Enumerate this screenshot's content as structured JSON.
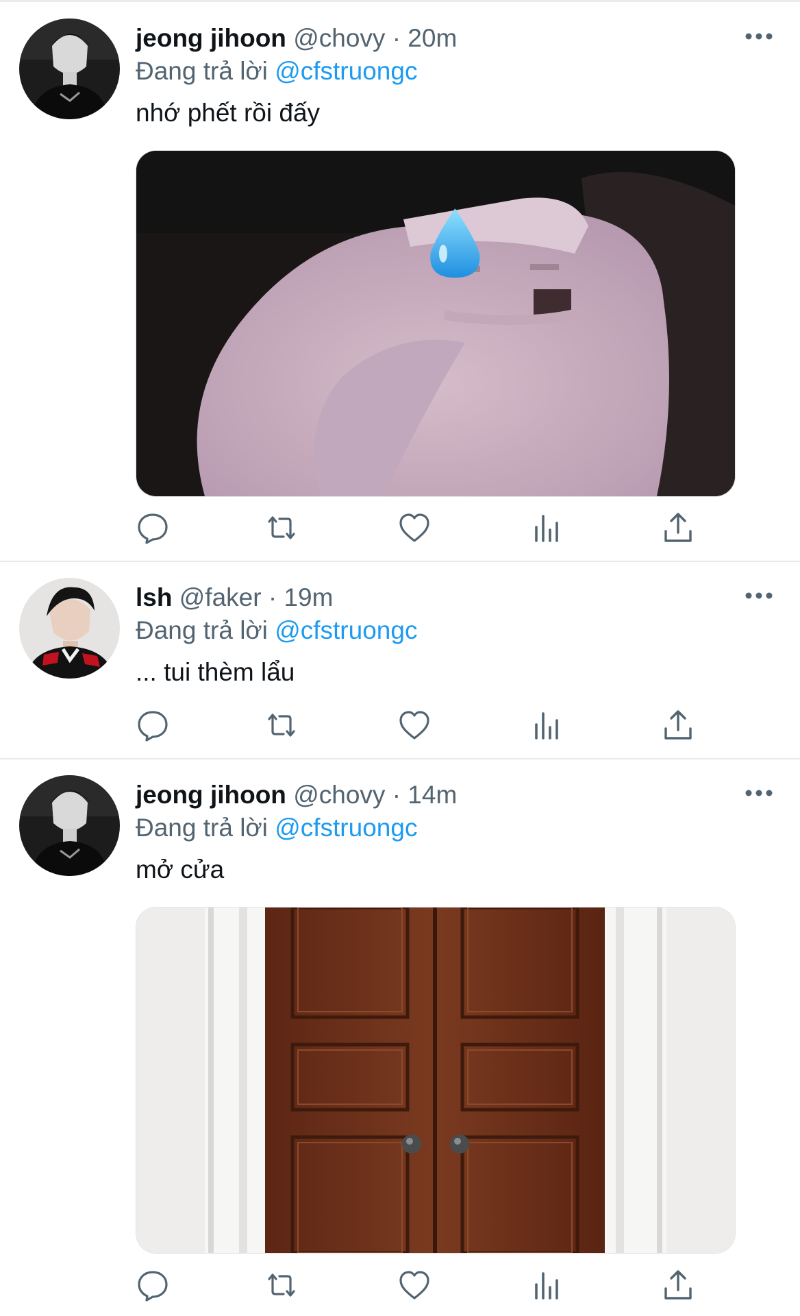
{
  "tweets": [
    {
      "name": "jeong jihoon",
      "handle": "@chovy",
      "separator": "·",
      "time": "20m",
      "reply_prefix": "Đang trả lời",
      "reply_to": "@cfstruongc",
      "text": "nhớ phết rồi đấy",
      "media": "sweating-dog-meme-image"
    },
    {
      "name": "lsh",
      "handle": "@faker",
      "separator": "·",
      "time": "19m",
      "reply_prefix": "Đang trả lời",
      "reply_to": "@cfstruongc",
      "text": "... tui thèm lẩu"
    },
    {
      "name": "jeong jihoon",
      "handle": "@chovy",
      "separator": "·",
      "time": "14m",
      "reply_prefix": "Đang trả lời",
      "reply_to": "@cfstruongc",
      "text": "mở cửa",
      "media": "wooden-double-door-image"
    }
  ],
  "actions": [
    "reply-icon",
    "retweet-icon",
    "like-icon",
    "analytics-icon",
    "share-icon"
  ],
  "colors": {
    "text": "#0f1419",
    "secondary": "#536471",
    "mention": "#1d9bf0",
    "icon": "#536471",
    "divider": "#e5e9ec"
  }
}
